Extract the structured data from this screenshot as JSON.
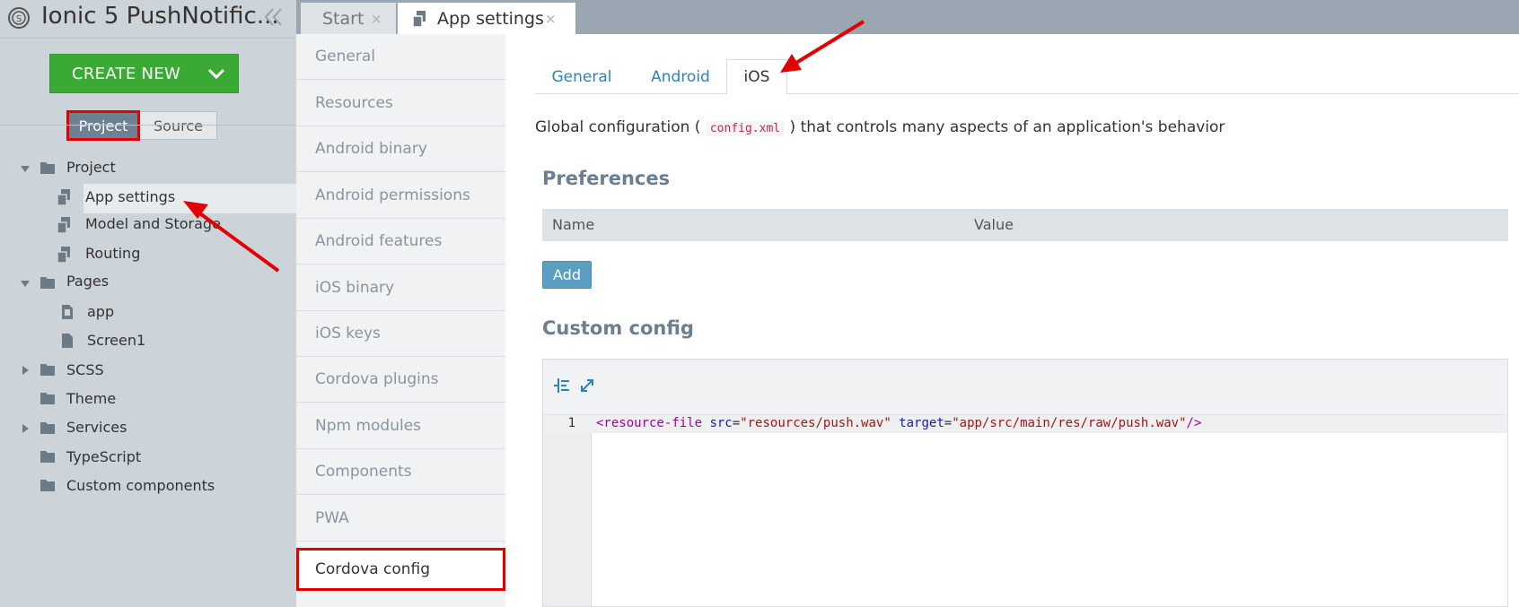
{
  "app": {
    "title": "Ionic 5 PushNotific...",
    "logo_icon": "app-logo-icon",
    "collapse_icon": "double-chevron-left-icon"
  },
  "sidebar": {
    "create_new_label": "CREATE NEW",
    "segment": {
      "project_label": "Project",
      "source_label": "Source"
    },
    "tree": [
      {
        "label": "Project",
        "type": "folder",
        "expanded": true
      },
      {
        "label": "App settings",
        "type": "settings",
        "selected": true
      },
      {
        "label": "Model and Storage",
        "type": "settings"
      },
      {
        "label": "Routing",
        "type": "settings"
      },
      {
        "label": "Pages",
        "type": "folder",
        "expanded": true
      },
      {
        "label": "app",
        "type": "page"
      },
      {
        "label": "Screen1",
        "type": "page"
      },
      {
        "label": "SCSS",
        "type": "folder",
        "expanded": false
      },
      {
        "label": "Theme",
        "type": "folder"
      },
      {
        "label": "Services",
        "type": "folder",
        "expanded": false
      },
      {
        "label": "TypeScript",
        "type": "folder"
      },
      {
        "label": "Custom components",
        "type": "folder"
      }
    ]
  },
  "tabs": {
    "start_label": "Start",
    "app_settings_label": "App settings",
    "close_glyph": "×"
  },
  "settings_menu": [
    "General",
    "Resources",
    "Android binary",
    "Android permissions",
    "Android features",
    "iOS binary",
    "iOS keys",
    "Cordova plugins",
    "Npm modules",
    "Components",
    "PWA",
    "Cordova config"
  ],
  "content": {
    "subtabs": {
      "general": "General",
      "android": "Android",
      "ios": "iOS",
      "active": "iOS"
    },
    "description_before": "Global configuration (",
    "description_code": "config.xml",
    "description_after": ") that controls many aspects of an application's behavior",
    "preferences_title": "Preferences",
    "table_headers": {
      "name": "Name",
      "value": "Value"
    },
    "add_label": "Add",
    "custom_config_title": "Custom config",
    "editor": {
      "line_number": "1",
      "code": {
        "open": "<resource-file",
        "attr1": "src",
        "val1": "\"resources/push.wav\"",
        "attr2": "target",
        "val2": "\"app/src/main/res/raw/push.wav\"",
        "close": "/>"
      }
    }
  },
  "colors": {
    "accent_green": "#3aaa35",
    "highlight_red": "#e00000",
    "link_blue": "#2a84b8",
    "segment_active": "#6c8191"
  }
}
